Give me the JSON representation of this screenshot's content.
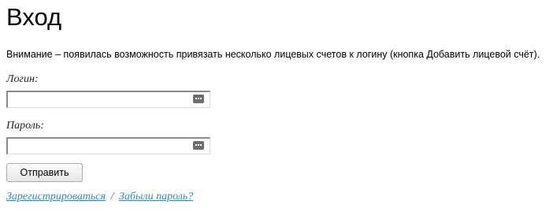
{
  "page": {
    "title": "Вход",
    "notice": "Внимание – появилась возможность привязать несколько лицевых счетов к логину (кнопка Добавить лицевой счёт)."
  },
  "form": {
    "login_label": "Логин:",
    "login_value": "",
    "password_label": "Пароль:",
    "password_value": "",
    "submit_label": "Отправить",
    "field_icon": "password-manager-key-icon"
  },
  "links": {
    "register": "Зарегистрироваться",
    "separator": "/",
    "forgot_password": "Забыли пароль?"
  },
  "colors": {
    "link": "#3a87b5",
    "text": "#000000",
    "background": "#ffffff"
  }
}
